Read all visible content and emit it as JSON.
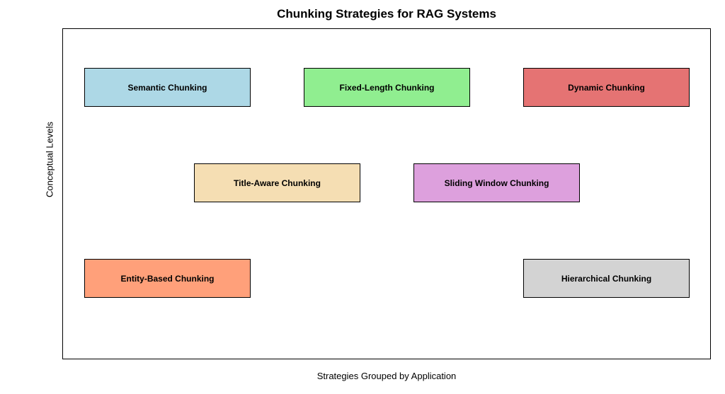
{
  "title": "Chunking Strategies for RAG Systems",
  "yLabel": "Conceptual Levels",
  "xLabel": "Strategies Grouped by Application",
  "boxes": {
    "semantic": "Semantic Chunking",
    "fixedLength": "Fixed-Length Chunking",
    "dynamic": "Dynamic Chunking",
    "titleAware": "Title-Aware Chunking",
    "slidingWindow": "Sliding Window Chunking",
    "entityBased": "Entity-Based Chunking",
    "hierarchical": "Hierarchical Chunking"
  },
  "chart_data": {
    "type": "table",
    "title": "Chunking Strategies for RAG Systems",
    "xlabel": "Strategies Grouped by Application",
    "ylabel": "Conceptual Levels",
    "nodes": [
      {
        "label": "Semantic Chunking",
        "row": 1,
        "color": "lightblue"
      },
      {
        "label": "Fixed-Length Chunking",
        "row": 1,
        "color": "lightgreen"
      },
      {
        "label": "Dynamic Chunking",
        "row": 1,
        "color": "lightred"
      },
      {
        "label": "Title-Aware Chunking",
        "row": 2,
        "color": "wheat"
      },
      {
        "label": "Sliding Window Chunking",
        "row": 2,
        "color": "plum"
      },
      {
        "label": "Entity-Based Chunking",
        "row": 3,
        "color": "lightsalmon"
      },
      {
        "label": "Hierarchical Chunking",
        "row": 3,
        "color": "lightgrey"
      }
    ]
  }
}
